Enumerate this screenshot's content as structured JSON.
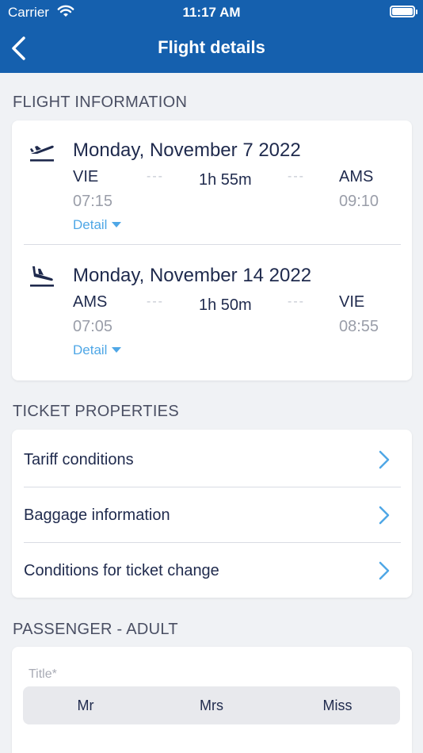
{
  "status_bar": {
    "carrier": "Carrier",
    "time": "11:17 AM"
  },
  "nav": {
    "title": "Flight details"
  },
  "flight_information": {
    "section_title": "FLIGHT INFORMATION",
    "flights": [
      {
        "icon": "airplane-takeoff-icon",
        "date": "Monday, November 7 2022",
        "from": "VIE",
        "to": "AMS",
        "duration": "1h 55m",
        "departure_time": "07:15",
        "arrival_time": "09:10",
        "dash": "---",
        "detail_label": "Detail"
      },
      {
        "icon": "airplane-landing-icon",
        "date": "Monday, November 14 2022",
        "from": "AMS",
        "to": "VIE",
        "duration": "1h 50m",
        "departure_time": "07:05",
        "arrival_time": "08:55",
        "dash": "---",
        "detail_label": "Detail"
      }
    ]
  },
  "ticket_properties": {
    "section_title": "TICKET PROPERTIES",
    "items": [
      {
        "label": "Tariff conditions"
      },
      {
        "label": "Baggage information"
      },
      {
        "label": "Conditions for ticket change"
      }
    ]
  },
  "passenger": {
    "section_title": "PASSENGER - ADULT",
    "title_label": "Title*",
    "title_options": [
      "Mr",
      "Mrs",
      "Miss"
    ]
  },
  "colors": {
    "brand": "#1560ae",
    "accent": "#4fa7e6",
    "text": "#1f2a4d",
    "background": "#f0f2f5"
  }
}
